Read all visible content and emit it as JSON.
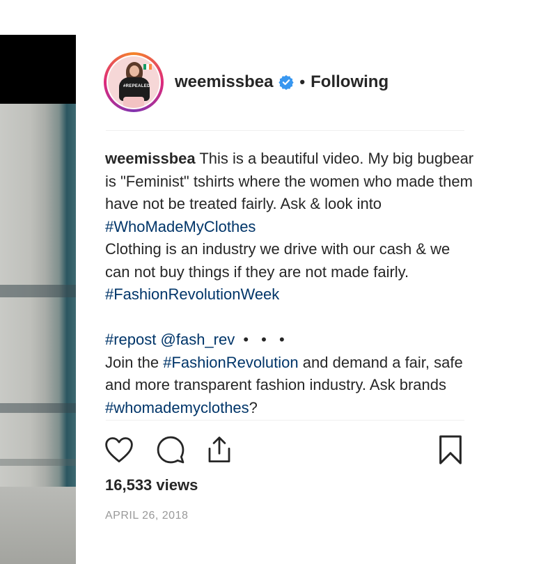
{
  "post": {
    "username": "weemissbea",
    "separator": "•",
    "follow_status": "Following",
    "avatar_shirt_text": "#REPEALED"
  },
  "caption": {
    "username": "weemissbea",
    "text_1": "This is a beautiful video. My big bugbear is \"Feminist\" tshirts where the women who made them have not be treated fairly. Ask & look into",
    "tag_1": "#WhoMadeMyClothes",
    "text_2": "Clothing is an industry we drive with our cash & we can not buy things if they are not made fairly.",
    "tag_2": "#FashionRevolutionWeek",
    "tag_3": "#repost",
    "mention": "@fash_rev",
    "more": "• • •",
    "text_3": "Join the",
    "tag_4": "#FashionRevolution",
    "text_4": "and demand a fair, safe and more transparent fashion industry. Ask brands",
    "tag_5": "#whomademyclothes",
    "text_5": "?"
  },
  "actions": {
    "like_icon": "heart-icon",
    "comment_icon": "comment-bubble-icon",
    "share_icon": "share-upload-icon",
    "save_icon": "bookmark-icon"
  },
  "stats": {
    "views": "16,533 views",
    "date": "APRIL 26, 2018"
  },
  "colors": {
    "hashtag": "#003569",
    "verified": "#3897f0",
    "text": "#262626",
    "muted": "#999999"
  }
}
